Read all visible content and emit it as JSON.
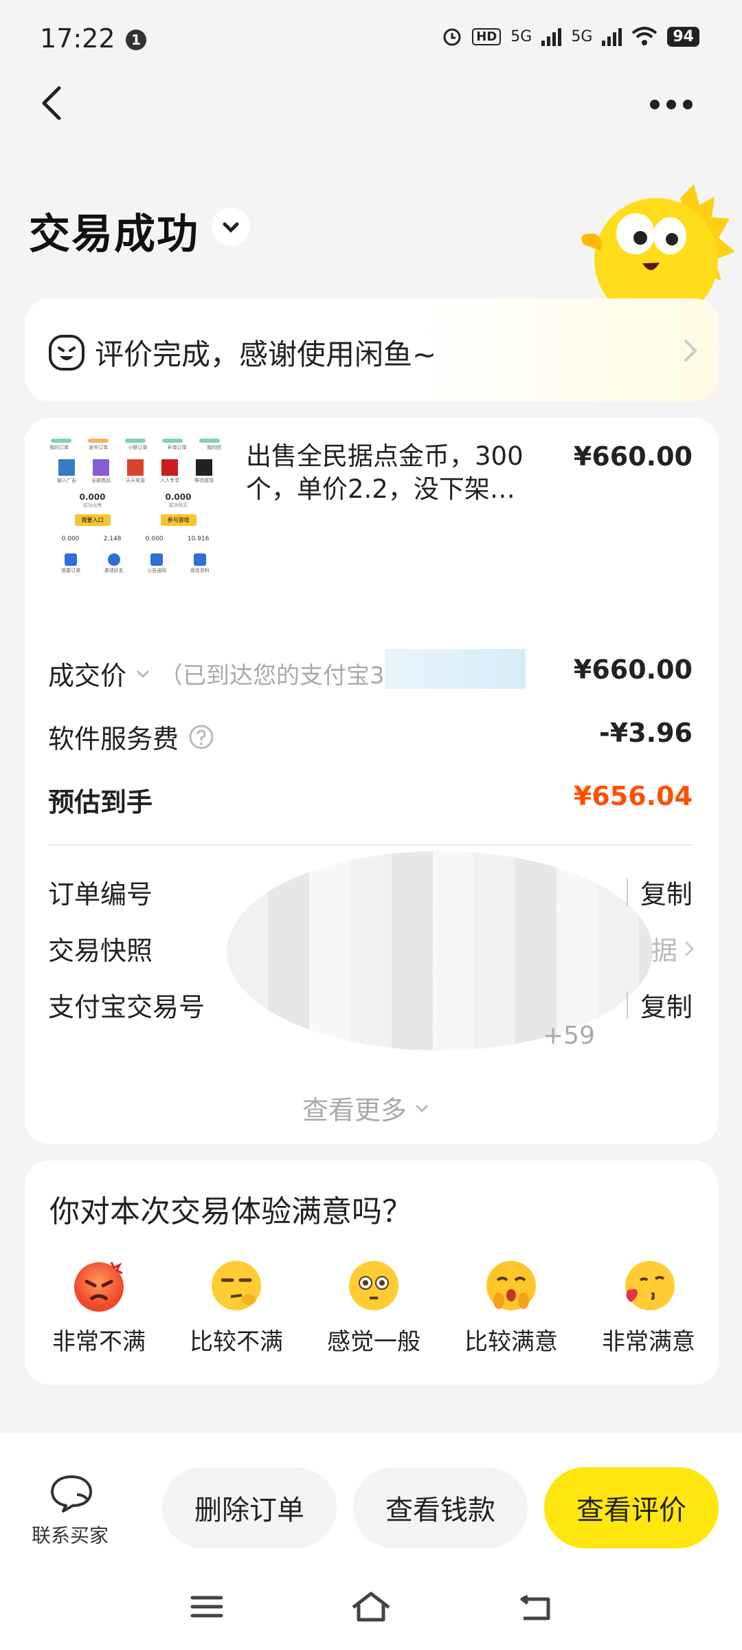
{
  "status_bar": {
    "time": "17:22",
    "notif_count": "1",
    "network1": "5G",
    "network2": "5G",
    "battery": "94"
  },
  "header": {
    "title": "交易成功"
  },
  "banner": {
    "text": "评价完成，感谢使用闲鱼~"
  },
  "product": {
    "title": "出售全民据点金币，300个，单价2.2，没下架…",
    "price": "¥660.00",
    "thumb": {
      "tabs": [
        "我的订单",
        "发布订单",
        "小额订单",
        "补单订单",
        "我的团"
      ],
      "grid_labels": [
        "链入广告",
        "全部商品",
        "天天来源",
        "人人专享",
        "等待提现"
      ],
      "stat_left": "0.000",
      "stat_left_label": "成功出售",
      "stat_right": "0.000",
      "stat_right_label": "成功购买",
      "btn_left": "我要入口",
      "btn_right": "参与游戏",
      "small_stats": [
        "0.000",
        "2.148",
        "0.000",
        "10.916"
      ],
      "bottom_labels": [
        "我要订单",
        "邀请好友",
        "公告通知",
        "修改资料"
      ]
    }
  },
  "rows": {
    "deal_label": "成交价",
    "deal_sub": "（已到达您的支付宝3",
    "deal_value": "¥660.00",
    "fee_label": "软件服务费",
    "fee_value": "-¥3.96",
    "net_label": "预估到手",
    "net_value": "¥656.04",
    "order_no_label": "订单编号",
    "snapshot_label": "交易快照",
    "snapshot_value": "据",
    "alipay_label": "支付宝交易号",
    "alipay_tail": "+59",
    "copy_label": "复制",
    "see_more": "查看更多"
  },
  "rating": {
    "question": "你对本次交易体验满意吗？",
    "options": [
      "非常不满",
      "比较不满",
      "感觉一般",
      "比较满意",
      "非常满意"
    ]
  },
  "bottom": {
    "contact": "联系买家",
    "delete": "删除订单",
    "view_money": "查看钱款",
    "view_review": "查看评价"
  },
  "colors": {
    "accent": "#ffe60f",
    "net_value": "#ff5000",
    "link_blue": "#1ba6e6"
  }
}
